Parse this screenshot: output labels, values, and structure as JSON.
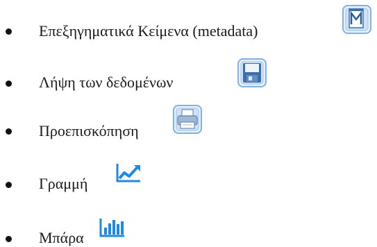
{
  "list": {
    "items": [
      {
        "label": "Επεξηγηματικά Κείμενα (metadata)",
        "icon": "metadata-document-icon"
      },
      {
        "label": "Λήψη των δεδομένων",
        "icon": "save-disk-icon"
      },
      {
        "label": "Προεπισκόπηση",
        "icon": "printer-icon"
      },
      {
        "label": "Γραμμή",
        "icon": "line-chart-icon"
      },
      {
        "label": "Μπάρα",
        "icon": "bar-chart-icon"
      }
    ]
  },
  "colors": {
    "text": "#1a1a1a",
    "bullet": "#111111",
    "icon_blue": "#1e88e5",
    "icon_frame": "#7fb2e5"
  }
}
